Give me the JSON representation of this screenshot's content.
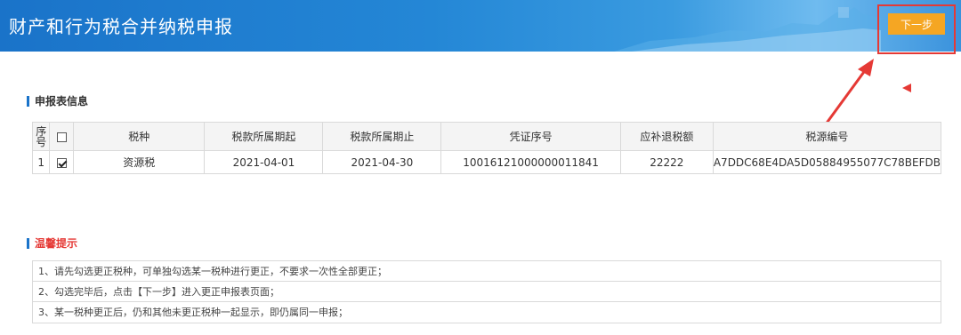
{
  "header": {
    "title": "财产和行为税合并纳税申报",
    "next_button": "下一步"
  },
  "declaration_section": {
    "title": "申报表信息",
    "columns": {
      "seq": "序号",
      "tax_type": "税种",
      "period_start": "税款所属期起",
      "period_end": "税款所属期止",
      "voucher_no": "凭证序号",
      "amount": "应补退税额",
      "source_no": "税源编号"
    },
    "rows": [
      {
        "seq": "1",
        "checked": true,
        "tax_type": "资源税",
        "period_start": "2021-04-01",
        "period_end": "2021-04-30",
        "voucher_no": "10016121000000011841",
        "amount": "22222",
        "source_no": "A7DDC68E4DA5D05884955077C78BEFDB"
      }
    ]
  },
  "tips_section": {
    "title": "温馨提示",
    "items": [
      "1、请先勾选更正税种，可单独勾选某一税种进行更正，不要求一次性全部更正；",
      "2、勾选完毕后，点击【下一步】进入更正申报表页面；",
      "3、某一税种更正后，仍和其他未更正税种一起显示，即仍属同一申报；"
    ]
  },
  "colors": {
    "header_blue": "#1a73c9",
    "button_orange": "#f5a623",
    "annotation_red": "#e53935"
  }
}
